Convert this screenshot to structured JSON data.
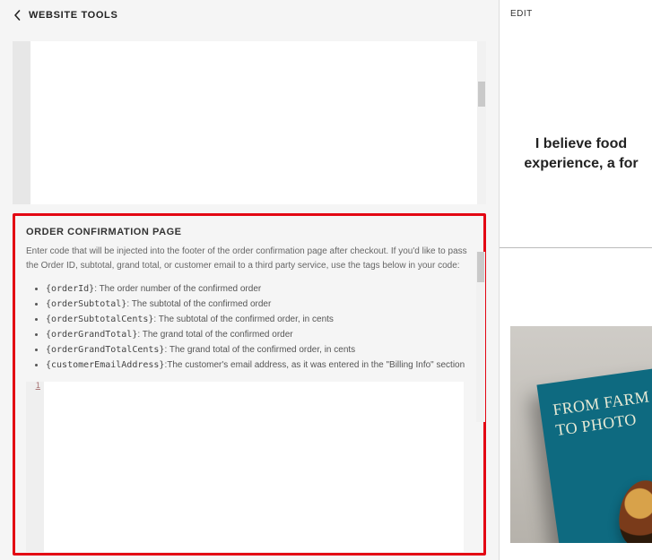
{
  "header": {
    "title": "WEBSITE TOOLS"
  },
  "section": {
    "title": "ORDER CONFIRMATION PAGE",
    "description": "Enter code that will be injected into the footer of the order confirmation page after checkout. If you'd like to pass the Order ID, subtotal, grand total, or customer email to a third party service, use the tags below in your code:",
    "tags": [
      {
        "tag": "{orderId}",
        "desc": ": The order number of the confirmed order"
      },
      {
        "tag": "{orderSubtotal}",
        "desc": ": The subtotal of the confirmed order"
      },
      {
        "tag": "{orderSubtotalCents}",
        "desc": ": The subtotal of the confirmed order, in cents"
      },
      {
        "tag": "{orderGrandTotal}",
        "desc": ": The grand total of the confirmed order"
      },
      {
        "tag": "{orderGrandTotalCents}",
        "desc": ": The grand total of the confirmed order, in cents"
      },
      {
        "tag": "{customerEmailAddress}",
        "desc": ":The customer's email address, as it was entered in the \"Billing Info\" section"
      }
    ],
    "line_number": "1"
  },
  "right": {
    "edit_label": "EDIT",
    "heading_line1": "I believe food",
    "heading_line2": "experience, a for",
    "book_line1": "FROM FARM",
    "book_line2": "TO PHOTO"
  }
}
